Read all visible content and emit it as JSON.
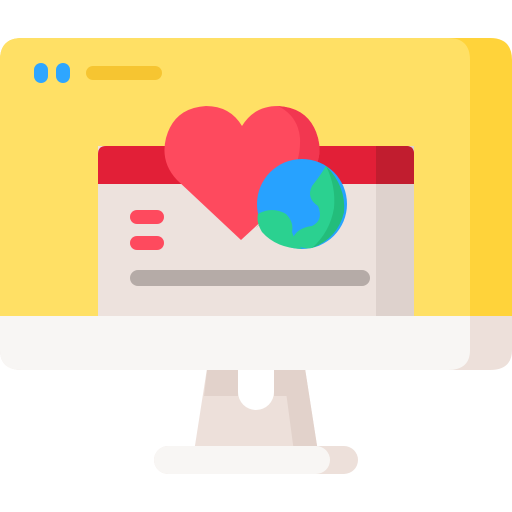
{
  "illustration": {
    "icon": "computer-monitor-with-heart-and-globe-icon",
    "colors": {
      "screen": "#FFE065",
      "screen_shade": "#FFD33A",
      "bezel": "#F8F6F4",
      "bezel_shade": "#EDE0DA",
      "stand": "#EDE0DA",
      "window_titlebar": "#E21F37",
      "window_titlebar_shade": "#C11D2F",
      "window_body": "#EDE2DD",
      "window_body_shade": "#DED2CD",
      "window_line": "#B5ABA7",
      "menu_dots": "#2EA6FF",
      "address_bar": "#F6C531",
      "accent_lines": "#FE4A5E",
      "heart": "#FE4A5E",
      "heart_shade": "#F23750",
      "globe_ocean": "#27A2FF",
      "globe_ocean_shade": "#1E85F2",
      "globe_land": "#2BD190",
      "globe_land_shade": "#23BD7B"
    }
  }
}
